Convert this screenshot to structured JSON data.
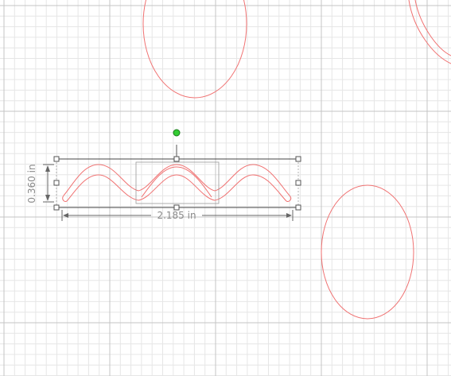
{
  "canvas": {
    "grid_minor_color": "#e6e6e6",
    "grid_major_color": "#c4c4c4",
    "shape_stroke_color": "#f07272",
    "rotation_handle_color": "#33cc33"
  },
  "selection": {
    "width_label": "2.185 in",
    "height_label": "0.360 in",
    "selected_shape": "wave-shape"
  },
  "icons": {
    "rotate_handle": "rotation-handle-icon",
    "resize_handle": "resize-handle-icon"
  }
}
